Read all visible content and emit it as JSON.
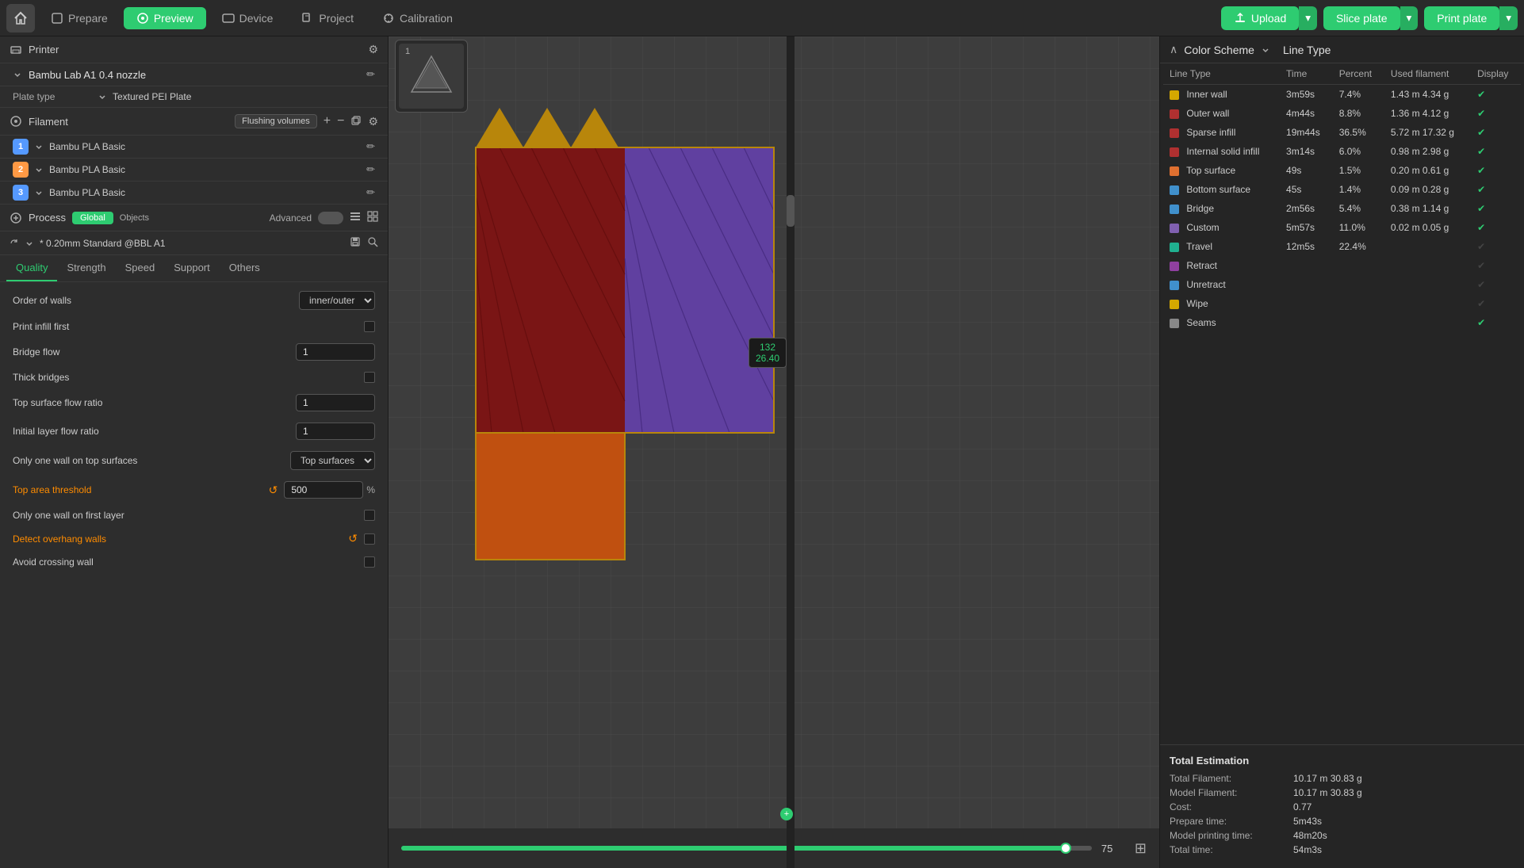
{
  "topbar": {
    "home_icon": "🏠",
    "tabs": [
      {
        "id": "prepare",
        "label": "Prepare",
        "active": false
      },
      {
        "id": "preview",
        "label": "Preview",
        "active": true
      },
      {
        "id": "device",
        "label": "Device",
        "active": false
      },
      {
        "id": "project",
        "label": "Project",
        "active": false
      },
      {
        "id": "calibration",
        "label": "Calibration",
        "active": false
      }
    ],
    "upload_label": "Upload",
    "slice_label": "Slice plate",
    "print_label": "Print plate"
  },
  "printer_section": {
    "title": "Printer",
    "printer_name": "Bambu Lab A1 0.4 nozzle",
    "plate_label": "Plate type",
    "plate_value": "Textured PEI Plate"
  },
  "filament_section": {
    "title": "Filament",
    "flush_label": "Flushing volumes",
    "items": [
      {
        "num": "1",
        "name": "Bambu PLA Basic",
        "class": "n1"
      },
      {
        "num": "2",
        "name": "Bambu PLA Basic",
        "class": "n2"
      },
      {
        "num": "3",
        "name": "Bambu PLA Basic",
        "class": "n3"
      }
    ]
  },
  "process_section": {
    "title": "Process",
    "global_label": "Global",
    "objects_label": "Objects",
    "advanced_label": "Advanced",
    "profile_name": "* 0.20mm Standard @BBL A1"
  },
  "tabs": {
    "items": [
      {
        "id": "quality",
        "label": "Quality",
        "active": true
      },
      {
        "id": "strength",
        "label": "Strength",
        "active": false
      },
      {
        "id": "speed",
        "label": "Speed",
        "active": false
      },
      {
        "id": "support",
        "label": "Support",
        "active": false
      },
      {
        "id": "others",
        "label": "Others",
        "active": false
      }
    ]
  },
  "quality_settings": {
    "order_of_walls": {
      "label": "Order of walls",
      "value": "inner/outer"
    },
    "print_infill_first": {
      "label": "Print infill first",
      "checked": false
    },
    "bridge_flow": {
      "label": "Bridge flow",
      "value": "1"
    },
    "thick_bridges": {
      "label": "Thick bridges",
      "checked": false
    },
    "top_surface_flow": {
      "label": "Top surface flow ratio",
      "value": "1"
    },
    "initial_layer_flow": {
      "label": "Initial layer flow ratio",
      "value": "1"
    },
    "only_one_wall_top": {
      "label": "Only one wall on top surfaces",
      "value": "Top surfaces"
    },
    "top_area_threshold": {
      "label": "Top area threshold",
      "value": "500",
      "unit": "%",
      "is_orange": true
    },
    "only_one_wall_first": {
      "label": "Only one wall on first layer",
      "checked": false
    },
    "detect_overhang": {
      "label": "Detect overhang walls",
      "checked": false,
      "is_orange": true
    },
    "avoid_crossing": {
      "label": "Avoid crossing wall",
      "checked": false
    }
  },
  "color_scheme": {
    "title": "Color Scheme",
    "line_type_title": "Line Type",
    "columns": [
      "Line Type",
      "Time",
      "Percent",
      "Used filament",
      "Display"
    ],
    "rows": [
      {
        "color": "#d4a800",
        "name": "Inner wall",
        "time": "3m59s",
        "percent": "7.4%",
        "used": "1.43 m  4.34 g",
        "display": true
      },
      {
        "color": "#c0392b",
        "name": "Outer wall",
        "time": "4m44s",
        "percent": "8.8%",
        "used": "1.36 m  4.12 g",
        "display": true
      },
      {
        "color": "#c0392b",
        "name": "Sparse infill",
        "time": "19m44s",
        "percent": "36.5%",
        "used": "5.72 m  17.32 g",
        "display": true
      },
      {
        "color": "#c0392b",
        "name": "Internal solid infill",
        "time": "3m14s",
        "percent": "6.0%",
        "used": "0.98 m  2.98 g",
        "display": true
      },
      {
        "color": "#e67e22",
        "name": "Top surface",
        "time": "49s",
        "percent": "1.5%",
        "used": "0.20 m  0.61 g",
        "display": true
      },
      {
        "color": "#3498db",
        "name": "Bottom surface",
        "time": "45s",
        "percent": "1.4%",
        "used": "0.09 m  0.28 g",
        "display": true
      },
      {
        "color": "#3498db",
        "name": "Bridge",
        "time": "2m56s",
        "percent": "5.4%",
        "used": "0.38 m  1.14 g",
        "display": true
      },
      {
        "color": "#9b59b6",
        "name": "Custom",
        "time": "5m57s",
        "percent": "11.0%",
        "used": "0.02 m  0.05 g",
        "display": true
      },
      {
        "color": "#1abc9c",
        "name": "Travel",
        "time": "12m5s",
        "percent": "22.4%",
        "used": "",
        "display": false
      },
      {
        "color": "#8e44ad",
        "name": "Retract",
        "time": "",
        "percent": "",
        "used": "",
        "display": false
      },
      {
        "color": "#3498db",
        "name": "Unretract",
        "time": "",
        "percent": "",
        "used": "",
        "display": false
      },
      {
        "color": "#d4a800",
        "name": "Wipe",
        "time": "",
        "percent": "",
        "used": "",
        "display": false
      },
      {
        "color": "#aaa",
        "name": "Seams",
        "time": "",
        "percent": "",
        "used": "",
        "display": true
      }
    ]
  },
  "estimation": {
    "title": "Total Estimation",
    "rows": [
      {
        "label": "Total Filament:",
        "value": "10.17 m  30.83 g"
      },
      {
        "label": "Model Filament:",
        "value": "10.17 m  30.83 g"
      },
      {
        "label": "Cost:",
        "value": "0.77"
      },
      {
        "label": "Prepare time:",
        "value": "5m43s"
      },
      {
        "label": "Model printing time:",
        "value": "48m20s"
      },
      {
        "label": "Total time:",
        "value": "54m3s"
      }
    ]
  },
  "slider": {
    "value": "75",
    "fill_percent": 96
  },
  "layer_indicator": {
    "top": "132",
    "bottom": "26.40"
  }
}
